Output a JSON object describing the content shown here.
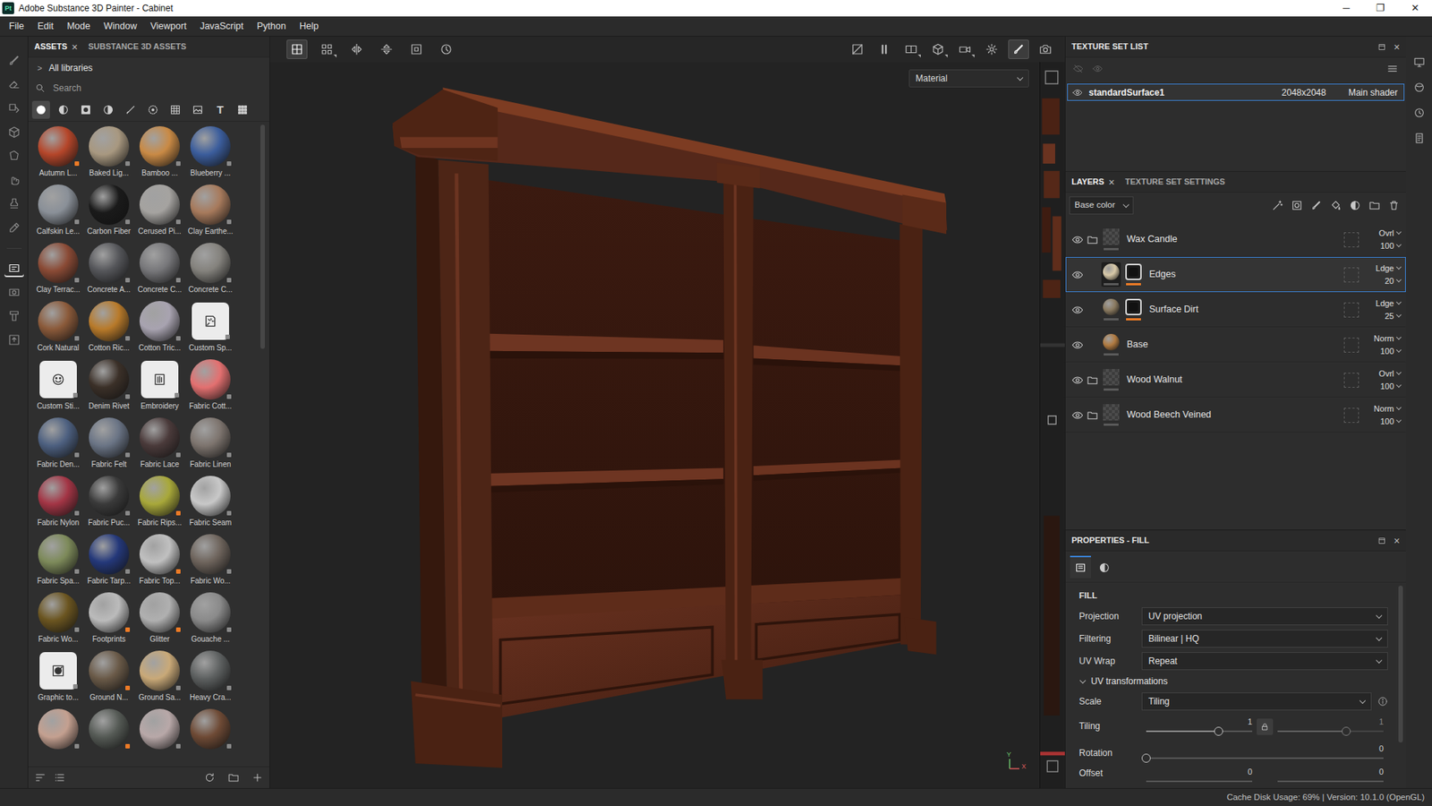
{
  "window": {
    "logo": "Pt",
    "title": "Adobe Substance 3D Painter - Cabinet",
    "controls": [
      "─",
      "❐",
      "✕"
    ]
  },
  "menu": [
    "File",
    "Edit",
    "Mode",
    "Window",
    "Viewport",
    "JavaScript",
    "Python",
    "Help"
  ],
  "tools": {
    "main": [
      {
        "kind": "paint",
        "selected": false
      },
      {
        "kind": "erase",
        "selected": false
      },
      {
        "kind": "project",
        "selected": false
      },
      {
        "kind": "geometry",
        "selected": false
      },
      {
        "kind": "polyfill",
        "selected": false
      },
      {
        "kind": "smudge",
        "selected": false
      },
      {
        "kind": "clone",
        "selected": false
      },
      {
        "kind": "picker",
        "selected": false
      }
    ],
    "extra": [
      {
        "kind": "bake",
        "selected": true
      },
      {
        "kind": "render",
        "selected": false
      },
      {
        "kind": "clean",
        "selected": false
      },
      {
        "kind": "export",
        "selected": false
      }
    ]
  },
  "assets": {
    "tabs": [
      {
        "label": "ASSETS",
        "close": "×",
        "selected": true
      },
      {
        "label": "SUBSTANCE 3D ASSETS",
        "selected": false
      }
    ],
    "breadcrumb": {
      "chevron": ">",
      "label": "All libraries"
    },
    "search": {
      "placeholder": "Search"
    },
    "filters": [
      {
        "kind": "materials",
        "selected": true
      },
      {
        "kind": "smart-materials",
        "selected": false
      },
      {
        "kind": "masks",
        "selected": false
      },
      {
        "kind": "generators",
        "selected": false
      },
      {
        "kind": "brushes",
        "selected": false
      },
      {
        "kind": "particles",
        "selected": false
      },
      {
        "kind": "alphas",
        "selected": false
      },
      {
        "kind": "textures",
        "selected": false
      },
      {
        "kind": "fonts",
        "glyph": "T",
        "selected": false
      },
      {
        "kind": "all",
        "selected": false
      }
    ],
    "items": [
      {
        "label": "Autumn L...",
        "kind": "ball",
        "color": "#b5462a",
        "flagged": true
      },
      {
        "label": "Baked Lig...",
        "kind": "ball",
        "color": "#a89880",
        "flagged": false
      },
      {
        "label": "Bamboo ...",
        "kind": "ball",
        "color": "#c98a45",
        "flagged": false
      },
      {
        "label": "Blueberry ...",
        "kind": "ball",
        "color": "#3b5d9c",
        "flagged": false
      },
      {
        "label": "Calfskin Le...",
        "kind": "ball",
        "color": "#8a9098",
        "flagged": false
      },
      {
        "label": "Carbon Fiber",
        "kind": "ball",
        "color": "#1a1a1a",
        "flagged": false
      },
      {
        "label": "Cerused Pi...",
        "kind": "ball",
        "color": "#a5a3a0",
        "flagged": false
      },
      {
        "label": "Clay Earthe...",
        "kind": "ball",
        "color": "#a77a5c",
        "flagged": false
      },
      {
        "label": "Clay Terrac...",
        "kind": "ball",
        "color": "#8a4a35",
        "flagged": false
      },
      {
        "label": "Concrete A...",
        "kind": "ball",
        "color": "#55565a",
        "flagged": false
      },
      {
        "label": "Concrete C...",
        "kind": "ball",
        "color": "#77777a",
        "flagged": false
      },
      {
        "label": "Concrete C...",
        "kind": "ball",
        "color": "#84827d",
        "flagged": false
      },
      {
        "label": "Cork Natural",
        "kind": "ball",
        "color": "#8b5a3a",
        "flagged": false
      },
      {
        "label": "Cotton Ric...",
        "kind": "ball",
        "color": "#b87a2a",
        "flagged": false
      },
      {
        "label": "Cotton Tric...",
        "kind": "ball",
        "color": "#a8a3b0",
        "flagged": false
      },
      {
        "label": "Custom Sp...",
        "kind": "tool",
        "color": "#ececec",
        "flagged": false
      },
      {
        "label": "Custom Sti...",
        "kind": "tool",
        "color": "#ececec",
        "flagged": false
      },
      {
        "label": "Denim Rivet",
        "kind": "ball",
        "color": "#3b3028",
        "flagged": false
      },
      {
        "label": "Embroidery",
        "kind": "tool",
        "color": "#ececec",
        "flagged": false
      },
      {
        "label": "Fabric Cott...",
        "kind": "ball",
        "color": "#e37070",
        "flagged": false
      },
      {
        "label": "Fabric Den...",
        "kind": "ball",
        "color": "#4d6080",
        "flagged": false
      },
      {
        "label": "Fabric Felt",
        "kind": "ball",
        "color": "#6a7485",
        "flagged": false
      },
      {
        "label": "Fabric Lace",
        "kind": "ball",
        "color": "#4a3a3a",
        "flagged": false
      },
      {
        "label": "Fabric Linen",
        "kind": "ball",
        "color": "#7d746e",
        "flagged": false
      },
      {
        "label": "Fabric Nylon",
        "kind": "ball",
        "color": "#a33545",
        "flagged": false
      },
      {
        "label": "Fabric Puc...",
        "kind": "ball",
        "color": "#3a3a3a",
        "flagged": false
      },
      {
        "label": "Fabric Rips...",
        "kind": "ball",
        "color": "#a8a83a",
        "flagged": true
      },
      {
        "label": "Fabric Seam",
        "kind": "ball",
        "color": "#c8c8c8",
        "flagged": false
      },
      {
        "label": "Fabric Spa...",
        "kind": "ball",
        "color": "#7d8a5a",
        "flagged": false
      },
      {
        "label": "Fabric Tarp...",
        "kind": "ball",
        "color": "#24387a",
        "flagged": false
      },
      {
        "label": "Fabric Top...",
        "kind": "ball",
        "color": "#c0c0c0",
        "flagged": true
      },
      {
        "label": "Fabric Wo...",
        "kind": "ball",
        "color": "#6e645c",
        "flagged": false
      },
      {
        "label": "Fabric Wo...",
        "kind": "ball",
        "color": "#6b5520",
        "flagged": false
      },
      {
        "label": "Footprints",
        "kind": "ball",
        "color": "#bbbbbb",
        "flagged": true
      },
      {
        "label": "Glitter",
        "kind": "ball",
        "color": "#b0b0b0",
        "flagged": true
      },
      {
        "label": "Gouache ...",
        "kind": "ball",
        "color": "#8a8a8a",
        "flagged": false
      },
      {
        "label": "Graphic to...",
        "kind": "tool",
        "color": "#ececec",
        "flagged": false
      },
      {
        "label": "Ground N...",
        "kind": "ball",
        "color": "#6a5a48",
        "flagged": true
      },
      {
        "label": "Ground Sa...",
        "kind": "ball",
        "color": "#c9a978",
        "flagged": false
      },
      {
        "label": "Heavy Cra...",
        "kind": "ball",
        "color": "#5d6060",
        "flagged": false
      },
      {
        "kind": "ball",
        "color": "#c4a090",
        "flagged": false
      },
      {
        "kind": "ball",
        "color": "#555a55",
        "flagged": true
      },
      {
        "kind": "ball",
        "color": "#b8a8a8",
        "flagged": false
      },
      {
        "kind": "ball",
        "color": "#6e4a35",
        "flagged": false
      }
    ]
  },
  "viewport": {
    "toolbar": {
      "left": [
        {
          "kind": "frame",
          "dropdown": false,
          "selected": true
        },
        {
          "kind": "grid",
          "dropdown": true,
          "selected": false
        },
        {
          "kind": "mirror-x",
          "dropdown": false,
          "selected": false
        },
        {
          "kind": "mirror-y",
          "dropdown": false,
          "selected": false
        },
        {
          "kind": "fit",
          "dropdown": false,
          "selected": false
        },
        {
          "kind": "reset",
          "dropdown": false,
          "selected": false
        }
      ],
      "right": [
        {
          "kind": "hide",
          "dropdown": false,
          "selected": false
        },
        {
          "kind": "pause",
          "dropdown": false,
          "selected": false
        },
        {
          "kind": "split",
          "dropdown": true,
          "selected": false
        },
        {
          "kind": "cube",
          "dropdown": true,
          "selected": false
        },
        {
          "kind": "camera",
          "dropdown": true,
          "selected": false
        },
        {
          "kind": "light",
          "dropdown": false,
          "selected": false
        },
        {
          "kind": "brush-mode",
          "dropdown": false,
          "selected": true
        },
        {
          "kind": "screenshot",
          "dropdown": false,
          "selected": false
        }
      ]
    },
    "mode": "Material",
    "axes": {
      "up": "Y",
      "right": "X"
    }
  },
  "texture_set_list": {
    "title": "TEXTURE SET LIST",
    "close": "×",
    "rows": [
      {
        "name": "standardSurface1",
        "size": "2048x2048",
        "shader": "Main shader",
        "visible": true,
        "selected": true
      }
    ]
  },
  "layers": {
    "tabs": [
      {
        "label": "LAYERS",
        "close": "×",
        "selected": true
      },
      {
        "label": "TEXTURE SET SETTINGS",
        "selected": false
      }
    ],
    "channel": "Base color",
    "rows": [
      {
        "name": "Wax Candle",
        "kind": "folder",
        "masked": false,
        "blend": "Ovrl",
        "opacity": "100",
        "visible": true,
        "selected": false
      },
      {
        "name": "Edges",
        "kind": "fill",
        "masked": true,
        "blend": "Ldge",
        "opacity": "20",
        "visible": true,
        "selected": true,
        "color": "#d8c9a8"
      },
      {
        "name": "Surface Dirt",
        "kind": "fill",
        "masked": true,
        "blend": "Ldge",
        "opacity": "25",
        "visible": true,
        "selected": false,
        "color": "#8a7a60"
      },
      {
        "name": "Base",
        "kind": "fill",
        "masked": false,
        "blend": "Norm",
        "opacity": "100",
        "visible": true,
        "selected": false,
        "color": "#b07a40"
      },
      {
        "name": "Wood Walnut",
        "kind": "folder",
        "masked": false,
        "blend": "Ovrl",
        "opacity": "100",
        "visible": true,
        "selected": false
      },
      {
        "name": "Wood Beech Veined",
        "kind": "folder",
        "masked": false,
        "blend": "Norm",
        "opacity": "100",
        "visible": true,
        "selected": false
      }
    ]
  },
  "properties": {
    "title": "PROPERTIES - FILL",
    "close": "×",
    "tabs": [
      {
        "kind": "settings",
        "selected": true
      },
      {
        "kind": "material",
        "selected": false
      }
    ],
    "section": "FILL",
    "fields": [
      {
        "kind": "select",
        "label": "Projection",
        "value": "UV projection"
      },
      {
        "kind": "select",
        "label": "Filtering",
        "value": "Bilinear | HQ"
      },
      {
        "kind": "select",
        "label": "UV Wrap",
        "value": "Repeat"
      },
      {
        "kind": "group",
        "label": "UV transformations",
        "expanded": true
      },
      {
        "kind": "select-info",
        "label": "Scale",
        "value": "Tiling"
      },
      {
        "kind": "pair-slider",
        "label": "Tiling",
        "locked": true,
        "sliders": [
          {
            "reading": "1",
            "level": 0.68,
            "disabled": false
          },
          {
            "reading": "1",
            "level": 0.65,
            "disabled": true
          }
        ]
      },
      {
        "kind": "slider",
        "label": "Rotation",
        "reading": "0",
        "level": 0
      },
      {
        "kind": "pair-readings",
        "label": "Offset",
        "readings": [
          "0",
          "0"
        ]
      }
    ]
  },
  "status_bar": {
    "text": "Cache Disk Usage: 69% | Version: 10.1.0 (OpenGL)"
  }
}
